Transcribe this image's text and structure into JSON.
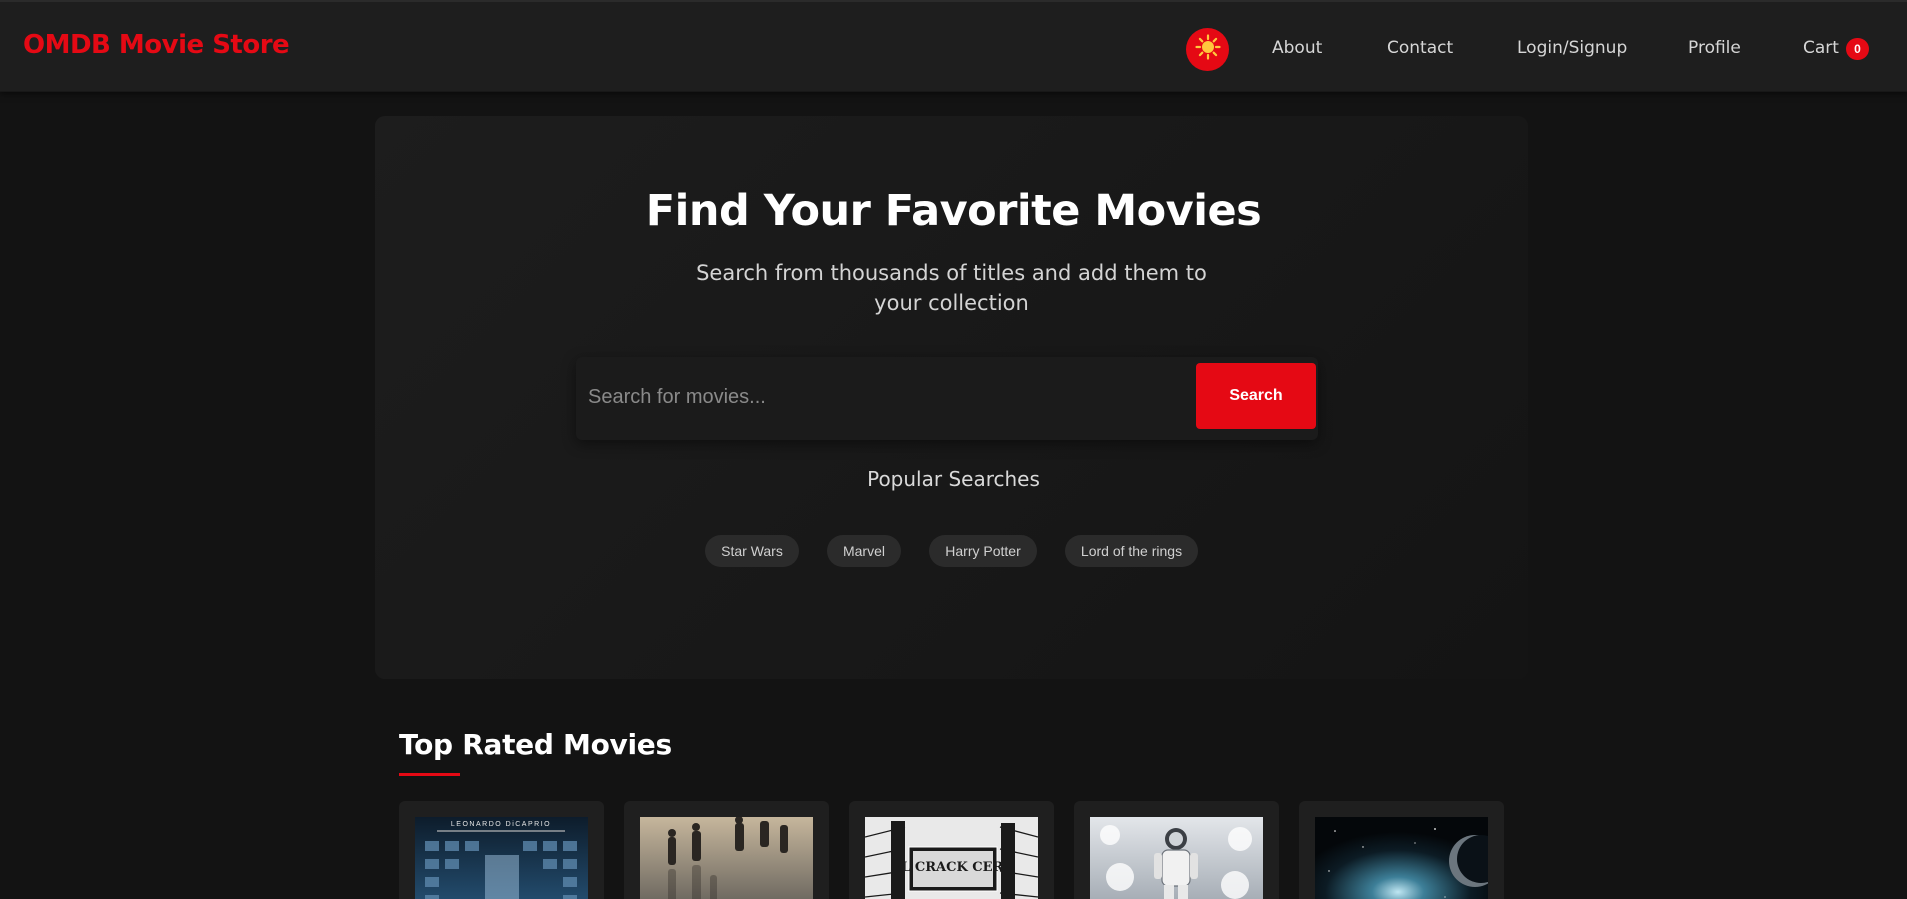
{
  "navbar": {
    "logo": "OMDB Movie Store",
    "theme_icon": "sun-icon",
    "links": {
      "about": "About",
      "contact": "Contact",
      "login": "Login/Signup",
      "profile": "Profile",
      "cart": "Cart"
    },
    "cart_count": "0"
  },
  "hero": {
    "title": "Find Your Favorite Movies",
    "subtitle": "Search from thousands of titles and add them to your collection",
    "search": {
      "placeholder": "Search for movies...",
      "value": "",
      "button_label": "Search"
    },
    "popular_heading": "Popular Searches",
    "popular_chips": [
      "Star Wars",
      "Marvel",
      "Harry Potter",
      "Lord of the rings"
    ]
  },
  "top_rated": {
    "title": "Top Rated Movies",
    "posters": [
      {
        "name": "poster-1",
        "poster_text": "LEONARDO DiCAPRIO"
      },
      {
        "name": "poster-2",
        "poster_text": ""
      },
      {
        "name": "poster-3",
        "poster_text": "EL CRACK CERO"
      },
      {
        "name": "poster-4",
        "poster_text": ""
      },
      {
        "name": "poster-5",
        "poster_text": ""
      }
    ]
  },
  "colors": {
    "accent": "#e50914",
    "background": "#131313",
    "navbar": "#1e1e1e",
    "chip": "#2b2b2b"
  }
}
